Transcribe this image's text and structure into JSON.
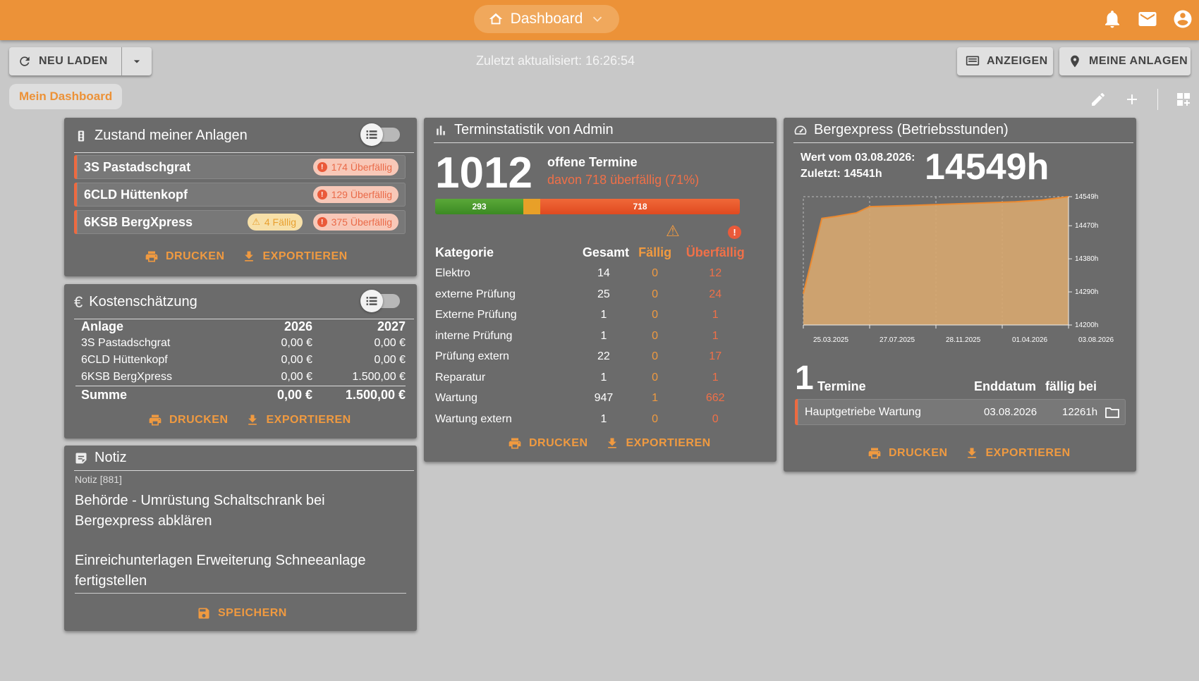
{
  "header": {
    "dashboard_label": "Dashboard",
    "icons": [
      "dashboard-icon",
      "chevron-down-icon",
      "bell-icon",
      "mail-icon",
      "account-icon"
    ]
  },
  "toolbar": {
    "reload_label": "NEU LADEN",
    "updated_text": "Zuletzt aktualisiert: 16:26:54",
    "show_label": "ANZEIGEN",
    "my_assets_label": "MEINE ANLAGEN",
    "tab_label": "Mein Dashboard"
  },
  "actions": {
    "print": "DRUCKEN",
    "export": "EXPORTIEREN",
    "save": "SPEICHERN"
  },
  "zustand": {
    "title": "Zustand meiner Anlagen",
    "rows": [
      {
        "name": "3S Pastadschgrat",
        "overdue": "174 Überfällig"
      },
      {
        "name": "6CLD Hüttenkopf",
        "overdue": "129 Überfällig"
      },
      {
        "name": "6KSB BergXpress",
        "due": "4 Fällig",
        "overdue": "375 Überfällig"
      }
    ]
  },
  "kosten": {
    "title": "Kostenschätzung",
    "header": [
      "Anlage",
      "2026",
      "2027"
    ],
    "rows": [
      [
        "3S Pastadschgrat",
        "0,00 €",
        "0,00 €"
      ],
      [
        "6CLD Hüttenkopf",
        "0,00 €",
        "0,00 €"
      ],
      [
        "6KSB BergXpress",
        "0,00 €",
        "1.500,00 €"
      ]
    ],
    "sum": [
      "Summe",
      "0,00 €",
      "1.500,00 €"
    ]
  },
  "notiz": {
    "title": "Notiz",
    "label": "Notiz [881]",
    "para1": "Behörde - Umrüstung Schaltschrank bei Bergexpress abklären",
    "para2": "Einreichunterlagen Erweiterung Schneeanlage fertigstellen"
  },
  "termin": {
    "title": "Terminstatistik von Admin",
    "total": "1012",
    "open_label": "offene Termine",
    "overdue_text": "davon  718 überfällig (71%)",
    "bar": {
      "ok": 293,
      "due": 1,
      "overdue": 718,
      "ok_label": "293",
      "overdue_label": "718"
    },
    "columns": [
      "Kategorie",
      "Gesamt",
      "Fällig",
      "Überfällig"
    ],
    "rows": [
      [
        "Elektro",
        "14",
        "0",
        "12"
      ],
      [
        "externe Prüfung",
        "25",
        "0",
        "24"
      ],
      [
        "Externe Prüfung",
        "1",
        "0",
        "1"
      ],
      [
        "interne Prüfung",
        "1",
        "0",
        "1"
      ],
      [
        "Prüfung extern",
        "22",
        "0",
        "17"
      ],
      [
        "Reparatur",
        "1",
        "0",
        "1"
      ],
      [
        "Wartung",
        "947",
        "1",
        "662"
      ],
      [
        "Wartung extern",
        "1",
        "0",
        "0"
      ]
    ]
  },
  "berg": {
    "title": "Bergexpress (Betriebsstunden)",
    "value_from": "Wert vom 03.08.2026:",
    "last": "Zuletzt: 14541h",
    "big": "14549h",
    "termine_count": "1",
    "termine_label": "Termine",
    "end_label": "Enddatum",
    "due_label": "fällig bei",
    "task": {
      "name": "Hauptgetriebe Wartung",
      "date": "03.08.2026",
      "hours": "12261h"
    }
  },
  "chart_data": {
    "type": "area",
    "ylim": [
      14200,
      14549
    ],
    "yticks": [
      "14549h",
      "14470h",
      "14380h",
      "14290h",
      "14200h"
    ],
    "ytick_values": [
      14549,
      14470,
      14380,
      14290,
      14200
    ],
    "xticks": [
      "25.03.2025",
      "27.07.2025",
      "28.11.2025",
      "01.04.2026",
      "03.08.2026"
    ],
    "x": [
      0,
      0.07,
      0.12,
      0.2,
      0.25,
      0.4,
      0.6,
      0.8,
      0.9,
      1.0
    ],
    "y": [
      14285,
      14490,
      14495,
      14505,
      14522,
      14525,
      14530,
      14535,
      14540,
      14549
    ],
    "color": "#d8a870"
  }
}
